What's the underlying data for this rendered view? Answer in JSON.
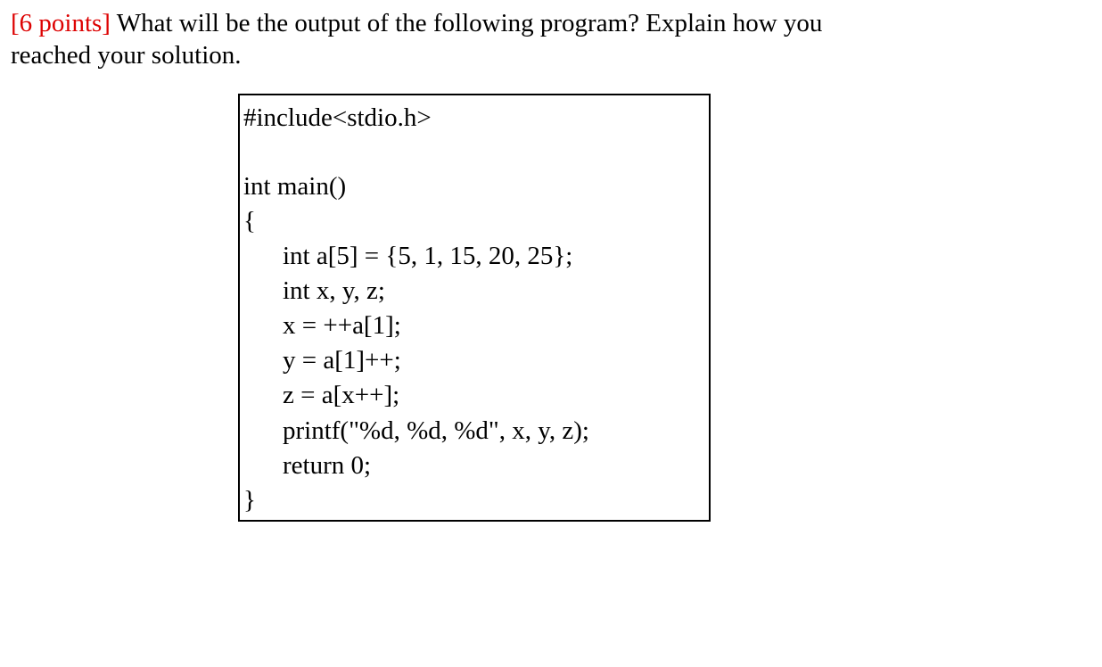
{
  "question": {
    "points_label": "[6 points]",
    "prompt_part1": " What will be the output of the following program?  Explain how you",
    "prompt_part2": "reached your solution."
  },
  "code": {
    "line1": "#include<stdio.h>",
    "line2": "int main()",
    "line3": "{",
    "line4": "int a[5] = {5, 1, 15, 20, 25};",
    "line5": "int x, y, z;",
    "line6": "x = ++a[1];",
    "line7": "y = a[1]++;",
    "line8": "z = a[x++];",
    "line9": "printf(\"%d, %d, %d\", x, y, z);",
    "line10": "return 0;",
    "line11": "}"
  }
}
